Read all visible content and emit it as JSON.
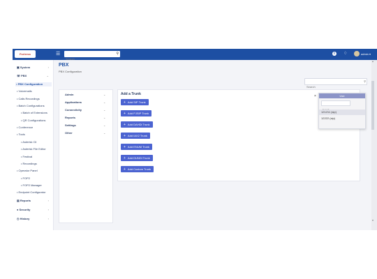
{
  "header": {
    "logo": "Fortress",
    "search_placeholder": "Search",
    "user": "admin"
  },
  "sidebar": {
    "items": [
      {
        "label": "System"
      },
      {
        "label": "PBX"
      },
      {
        "label": "PBX Configuration"
      },
      {
        "label": "Voicemails"
      },
      {
        "label": "Calls Recordings"
      },
      {
        "label": "Batch Configurations"
      },
      {
        "label": "Batch of Extensions"
      },
      {
        "label": "QR Configurations"
      },
      {
        "label": "Conference"
      },
      {
        "label": "Tools"
      },
      {
        "label": "Asterisk Cli"
      },
      {
        "label": "Asterisk File Editor"
      },
      {
        "label": "Festival"
      },
      {
        "label": "Recordings"
      },
      {
        "label": "Operator Panel"
      },
      {
        "label": "FOP2"
      },
      {
        "label": "FOP2 Manager"
      },
      {
        "label": "Endpoint Configurator"
      },
      {
        "label": "Reports"
      },
      {
        "label": "Security"
      },
      {
        "label": "History"
      }
    ]
  },
  "page": {
    "title": "PBX",
    "subtitle": "PBX Configuration",
    "search_placeholder": "Search"
  },
  "menu": {
    "items": [
      {
        "label": "Admin"
      },
      {
        "label": "Applications"
      },
      {
        "label": "Connectivity"
      },
      {
        "label": "Reports"
      },
      {
        "label": "Settings"
      },
      {
        "label": "Other"
      }
    ]
  },
  "content": {
    "title": "Add a Trunk",
    "buttons": [
      {
        "label": "Add SIP Trunk"
      },
      {
        "label": "Add PJSIP Trunk"
      },
      {
        "label": "Add DAHDi Trunk"
      },
      {
        "label": "Add IAX2 Trunk"
      },
      {
        "label": "Add ENUM Trunk"
      },
      {
        "label": "Add DUNDi Trunk"
      },
      {
        "label": "Add Custom Trunk"
      }
    ]
  },
  "dropdown": {
    "header": "Use",
    "search_placeholder": "Search",
    "options": [
      {
        "label": "121211 (sip)",
        "selected": true
      },
      {
        "label": "12222 (sip)",
        "selected": false
      }
    ]
  },
  "colors": {
    "primary": "#1d4fa3",
    "button": "#4b63d1",
    "background": "#f3f4f8"
  }
}
